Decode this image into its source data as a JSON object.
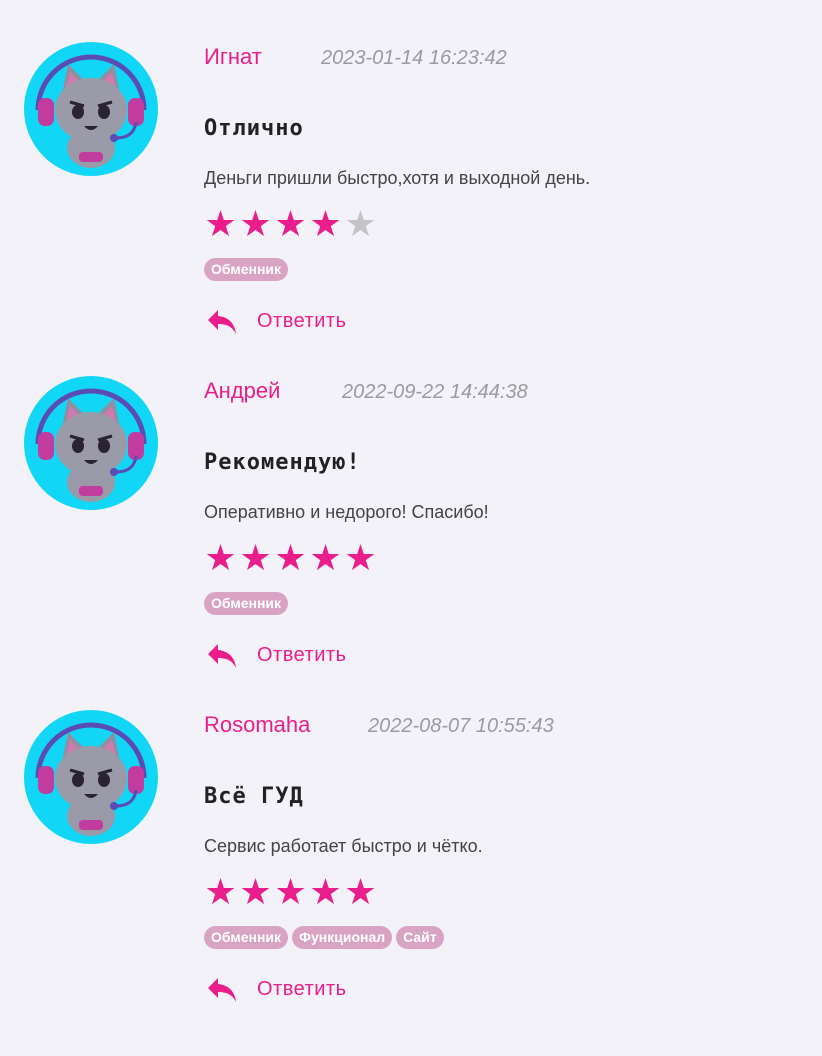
{
  "colors": {
    "accent": "#e91e8c",
    "star_off": "#c4c4c8",
    "tag_bg": "#d9a3c4",
    "avatar_bg": "#12d6f5",
    "page_bg": "#f2f2f8"
  },
  "reviews": [
    {
      "author": "Игнат",
      "date": "2023-01-14 16:23:42",
      "title": "Отлично",
      "text": "Деньги пришли быстро,хотя и выходной день.",
      "rating": 4,
      "tags": [
        "Обменник"
      ],
      "reply_label": "Ответить",
      "avatar_icon": "cat-gamer-headset-icon"
    },
    {
      "author": "Андрей",
      "date": "2022-09-22 14:44:38",
      "title": "Рекомендую!",
      "text": "Оперативно и недорого! Спасибо!",
      "rating": 5,
      "tags": [
        "Обменник"
      ],
      "reply_label": "Ответить",
      "avatar_icon": "cat-gamer-headset-icon"
    },
    {
      "author": "Rosomaha",
      "date": "2022-08-07 10:55:43",
      "title": "Всё ГУД",
      "text": "Сервис работает быстро и чётко.",
      "rating": 5,
      "tags": [
        "Обменник",
        "Функционал",
        "Сайт"
      ],
      "reply_label": "Ответить",
      "avatar_icon": "cat-gamer-headset-icon"
    }
  ]
}
